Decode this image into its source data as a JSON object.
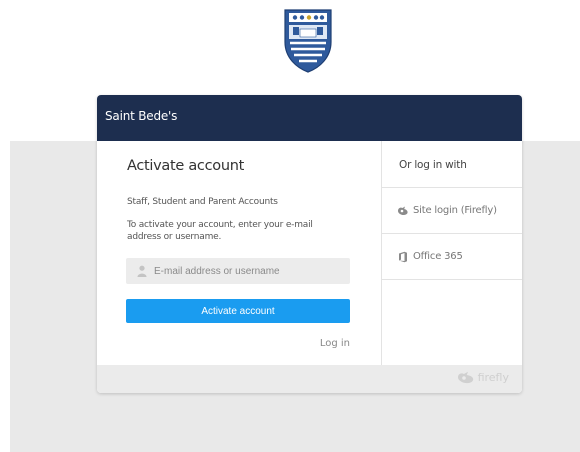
{
  "school": {
    "name": "Saint Bede's",
    "crest_icon": "school-crest-icon",
    "crest_colors": {
      "shield": "#2f5a9c",
      "stripes": "#ffffff",
      "banner": "#ffffff"
    }
  },
  "activate": {
    "title": "Activate account",
    "subtitle": "Staff, Student and Parent Accounts",
    "description": "To activate your account, enter your e-mail address or username.",
    "input": {
      "value": "",
      "placeholder": "E-mail address or username",
      "icon": "user-icon"
    },
    "button_label": "Activate account",
    "login_link": "Log in"
  },
  "alt_login": {
    "heading": "Or log in with",
    "providers": [
      {
        "label": "Site login (Firefly)",
        "icon": "firefly-icon"
      },
      {
        "label": "Office 365",
        "icon": "office-icon"
      }
    ]
  },
  "footer": {
    "brand": "firefly",
    "icon": "firefly-logo-icon"
  },
  "colors": {
    "header": "#1d2e4f",
    "button": "#1a9cf0",
    "background_band": "#e9e9e9"
  }
}
